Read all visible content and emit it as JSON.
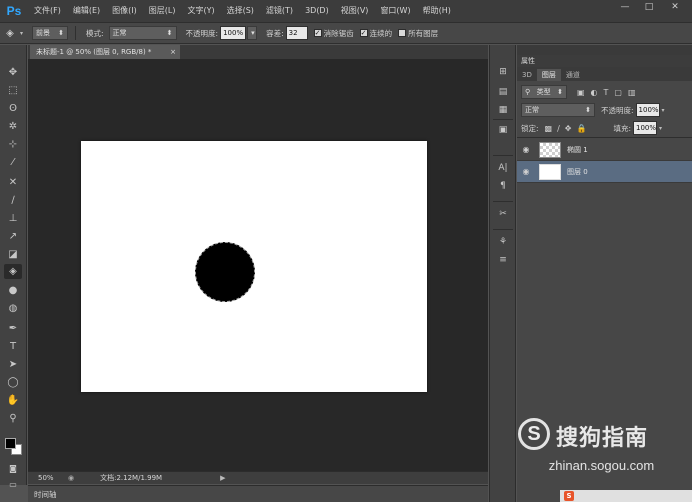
{
  "app": {
    "logo": "Ps"
  },
  "menu": [
    "文件(F)",
    "编辑(E)",
    "图像(I)",
    "图层(L)",
    "文字(Y)",
    "选择(S)",
    "滤镜(T)",
    "3D(D)",
    "视图(V)",
    "窗口(W)",
    "帮助(H)"
  ],
  "window_controls": {
    "minimize": "—",
    "restore": "□",
    "close": "✕"
  },
  "options": {
    "fill_source": "前景",
    "mode_label": "模式:",
    "mode_value": "正常",
    "opacity_label": "不透明度:",
    "opacity_value": "100%",
    "tolerance_label": "容差:",
    "tolerance_value": "32",
    "antialias_label": "消除锯齿",
    "contiguous_label": "连续的",
    "all_layers_label": "所有图层"
  },
  "document": {
    "tab_title": "未标题-1 @ 50% (图层 0, RGB/8) *",
    "tab_close": "×"
  },
  "status": {
    "zoom": "50%",
    "doc_info": "文档:2.12M/1.99M"
  },
  "timeline_label": "时间轴",
  "panel": {
    "title": "属性",
    "tabs": [
      "3D",
      "图层",
      "通道"
    ],
    "filter_kind": "类型",
    "blend_mode": "正常",
    "opacity_label": "不透明度:",
    "opacity_value": "100%",
    "lock_label": "锁定:",
    "fill_label": "填充:",
    "fill_value": "100%",
    "layers": [
      {
        "name": "椭圆 1"
      },
      {
        "name": "图层 0"
      }
    ]
  },
  "watermark": {
    "logo": "S",
    "brand": "搜狗指南",
    "url": "zhinan.sogou.com"
  },
  "colors": {
    "menu_bg": "#3c3c3c",
    "panel_bg": "#474747",
    "workspace_bg": "#282828",
    "selected_layer": "#5a6c82",
    "accent": "#31a8ff"
  }
}
